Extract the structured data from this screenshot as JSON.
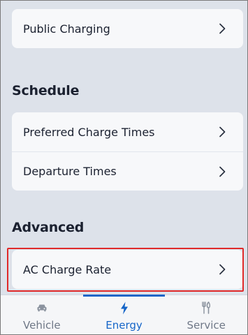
{
  "sections": {
    "top": {
      "items": [
        {
          "label": "Public Charging",
          "icon": "chevron-right-icon"
        }
      ]
    },
    "schedule": {
      "title": "Schedule",
      "items": [
        {
          "label": "Preferred Charge Times",
          "icon": "chevron-right-icon"
        },
        {
          "label": "Departure Times",
          "icon": "chevron-right-icon"
        }
      ]
    },
    "advanced": {
      "title": "Advanced",
      "items": [
        {
          "label": "AC Charge Rate",
          "icon": "chevron-right-icon",
          "highlighted": true
        }
      ]
    }
  },
  "tabbar": {
    "tabs": [
      {
        "label": "Vehicle",
        "icon": "car-icon",
        "active": false
      },
      {
        "label": "Energy",
        "icon": "lightning-icon",
        "active": true
      },
      {
        "label": "Service",
        "icon": "wrench-fork-icon",
        "active": false
      }
    ]
  },
  "colors": {
    "background": "#dde2ea",
    "card": "#f7f8fa",
    "accent": "#1565c8",
    "highlight_border": "#e02a2a",
    "inactive_tab": "#6f7887"
  }
}
